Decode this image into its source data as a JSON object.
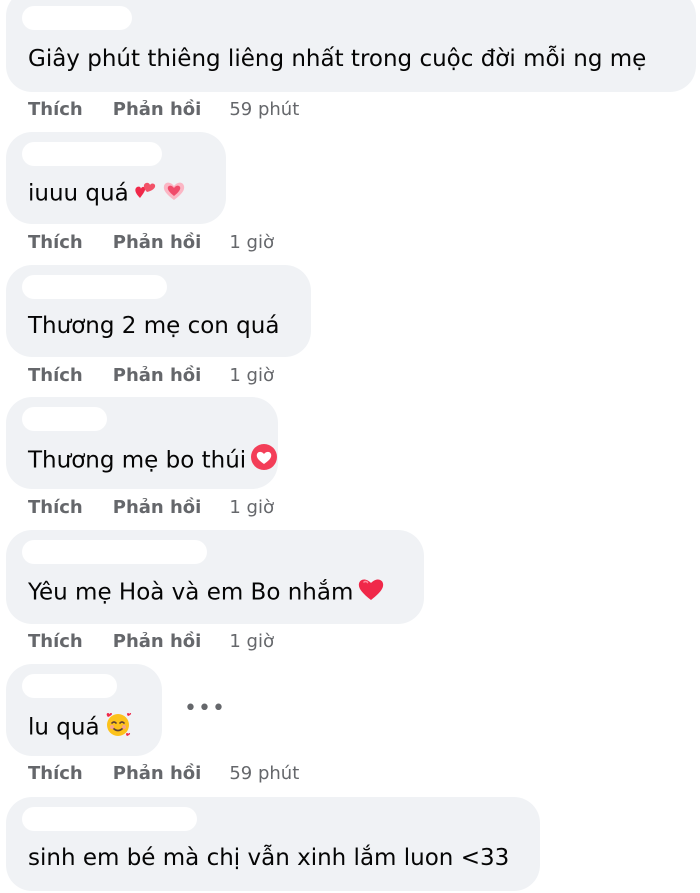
{
  "actions": {
    "like_label": "Thích",
    "reply_label": "Phản hồi"
  },
  "comments": [
    {
      "text": "Giây phút thiêng liêng nhất trong cuộc đời mỗi ng mẹ",
      "time": "59 phút",
      "emoji": []
    },
    {
      "text": "iuuu quá",
      "time": "1 giờ",
      "emoji": [
        "two-hearts-icon",
        "growing-heart-icon"
      ]
    },
    {
      "text": "Thương 2 mẹ con quá",
      "time": "1 giờ",
      "emoji": []
    },
    {
      "text": "Thương mẹ bo thúi",
      "time": "1 giờ",
      "emoji": [
        "love-reaction-icon"
      ]
    },
    {
      "text": "Yêu mẹ Hoà và em Bo nhắm",
      "time": "1 giờ",
      "emoji": [
        "red-heart-icon"
      ]
    },
    {
      "text": "lu quá",
      "time": "59 phút",
      "emoji": [
        "smiling-face-with-hearts-icon"
      ]
    },
    {
      "text": "sinh em bé mà chị vẫn xinh lắm luon <33",
      "time": "",
      "emoji": []
    }
  ],
  "more_options_label": "•••",
  "colors": {
    "bubble": "#f0f2f5",
    "meta_text": "#65676b",
    "text": "#050505",
    "heart_red": "#f02849"
  }
}
